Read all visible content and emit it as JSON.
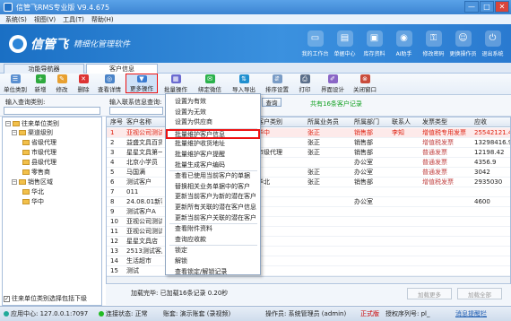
{
  "window": {
    "title": "信管飞RMS专业版 V9.4.675",
    "buttons": [
      "—",
      "□",
      "✕"
    ]
  },
  "menu": [
    "系统(S)",
    "视图(V)",
    "工具(T)",
    "帮助(H)"
  ],
  "banner": {
    "logo": "信管飞",
    "slogan": "精细化管理软件"
  },
  "topnav": [
    "我的工作台",
    "单据中心",
    "库存资料",
    "AI助手",
    "修改密码",
    "更换操作员",
    "退出系统"
  ],
  "tabs": [
    "功能导航器",
    "客户信息"
  ],
  "toolbar": [
    "单位类别",
    "新增",
    "修改",
    "删除",
    "查看详情",
    "更多操作",
    "批量操作",
    "绑定微信",
    "导入导出",
    "排序设置",
    "打印",
    "界面设计",
    "关闭窗口"
  ],
  "filter": {
    "label1": "输入查询类别:",
    "label2": "输入联系信息查询:",
    "search_btn": "查询",
    "count": "共有16条客户记录"
  },
  "tree": {
    "root": "往来单位类别",
    "nodes": [
      "渠道级别",
      "省级代理",
      "市级代理",
      "县级代理",
      "零售商",
      "销售区域",
      "华北",
      "华中"
    ],
    "footer": "往来单位类别选择包括下级"
  },
  "grid": {
    "headers": [
      "序号",
      "客户名称",
      "",
      "",
      "",
      "客户类别",
      "所属业务员",
      "所属部门",
      "联系人",
      "发票类型",
      "应收"
    ],
    "rows": [
      [
        "1",
        "亚视公司测试",
        "",
        "",
        "",
        "华中",
        "张正",
        "销售部",
        "李知",
        "增值税专用发票",
        "25542121.43"
      ],
      [
        "2",
        "益盛文具百货",
        "",
        "",
        "",
        "",
        "张正",
        "销售部",
        "",
        "增值税发票",
        "13298416.9"
      ],
      [
        "3",
        "星星文具第一",
        "",
        "",
        "",
        "市级代理",
        "张正",
        "销售部",
        "",
        "普通发票",
        "12198.42"
      ],
      [
        "4",
        "北京小学员",
        "",
        "",
        "",
        "",
        "",
        "办公室",
        "",
        "普通发票",
        "4356.9"
      ],
      [
        "5",
        "马国满",
        "",
        "",
        "",
        "",
        "张正",
        "办公室",
        "",
        "普通发票",
        "3042"
      ],
      [
        "6",
        "测试客户",
        "",
        "",
        "",
        "华北",
        "张正",
        "销售部",
        "",
        "增值税发票",
        "2935030"
      ],
      [
        "7",
        "011",
        "",
        "",
        "",
        "",
        "",
        "",
        "",
        "",
        ""
      ],
      [
        "8",
        "24.08.01新客户",
        "",
        "",
        "",
        "",
        "",
        "办公室",
        "",
        "",
        "4600"
      ],
      [
        "9",
        "测试客户A",
        "",
        "",
        "",
        "",
        "",
        "",
        "",
        "",
        ""
      ],
      [
        "10",
        "亚视公司测试",
        "",
        "",
        "",
        "",
        "",
        "",
        "",
        "",
        ""
      ],
      [
        "11",
        "亚视公司测试",
        "",
        "",
        "",
        "",
        "",
        "",
        "",
        "",
        ""
      ],
      [
        "12",
        "星星文具店",
        "",
        "",
        "",
        "",
        "",
        "",
        "",
        "",
        ""
      ],
      [
        "13",
        "2513测试客户",
        "",
        "",
        "",
        "",
        "",
        "",
        "",
        "",
        ""
      ],
      [
        "14",
        "生活超市",
        "",
        "",
        "",
        "",
        "",
        "",
        "",
        "",
        ""
      ],
      [
        "15",
        "测试",
        "",
        "",
        "",
        "",
        "",
        "",
        "",
        "",
        ""
      ]
    ]
  },
  "ctxmenu": [
    "设置为有效",
    "设置为无效",
    "设置为供应商",
    "批量维护客户信息",
    "批量维护收货地址",
    "批量维护客户提醒",
    "批量生成客户编码",
    "查看已使用当前客户的单据",
    "替换相关业务单据中的客户",
    "更新当前客户为新的潜在客户",
    "更新所有关联的潜在客户信息",
    "更新当前客户关联的潜在客户",
    "查看附件资料",
    "查询应收款",
    "锁定",
    "解锁",
    "查看锁定/解锁记录"
  ],
  "statusline": {
    "text": "加载完毕: 已加载16条记录 0.20秒",
    "btn1": "加载更多",
    "btn2": "加载全部"
  },
  "bottombar": {
    "server": "应用中心: 127.0.0.1:7097",
    "conn": "连接状态: 正常",
    "db": "账套: 演示账套 (录视频)",
    "user": "操作员: 系统管理员 (admin)",
    "version": "正式版",
    "serial": "授权序列号: pl_",
    "notice": "消息提醒栏"
  },
  "colors": {
    "accent": "#3b84d2",
    "highlight": "#e11111",
    "count_green": "#10a020"
  }
}
